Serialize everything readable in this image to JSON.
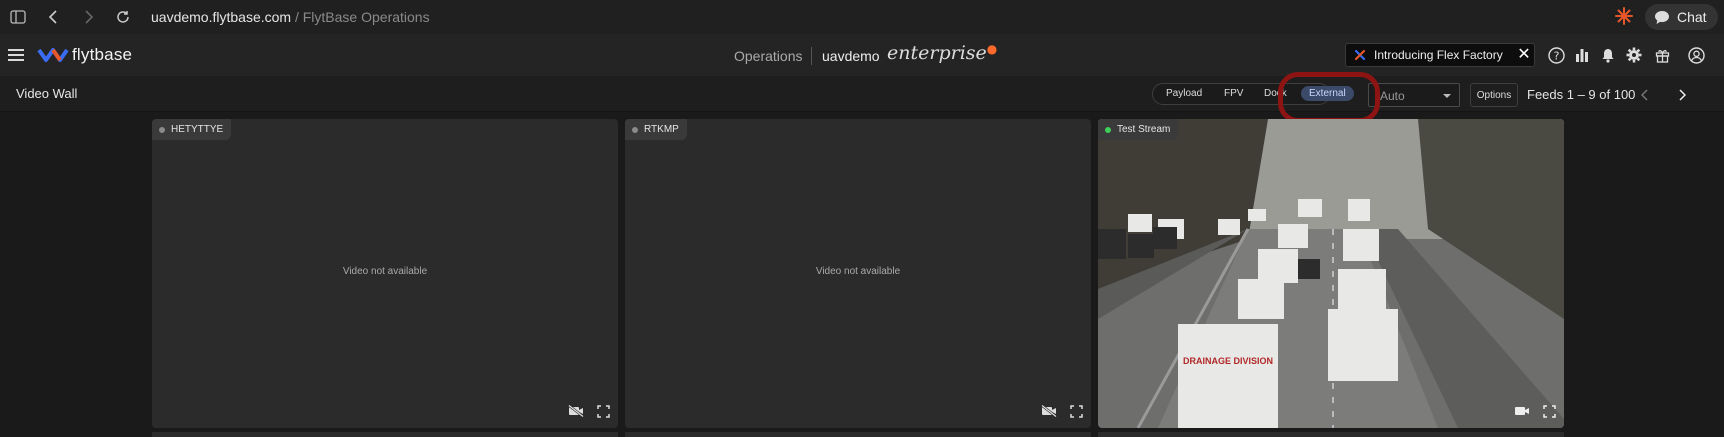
{
  "browser": {
    "url_domain": "uavdemo.flytbase.com",
    "url_separator": " / ",
    "url_page": "FlytBase Operations",
    "chat_label": "Chat"
  },
  "header": {
    "logo_text": "flytbase",
    "section": "Operations",
    "org": "uavdemo",
    "edition": "enterprise",
    "promo": {
      "text": "Introducing Flex Factory"
    }
  },
  "subheader": {
    "title": "Video Wall",
    "filters": [
      "Payload",
      "FPV",
      "Dock",
      "External"
    ],
    "active_filter": "External",
    "quality_value": "Auto",
    "options_label": "Options",
    "feeds_text": "Feeds 1 – 9 of 100"
  },
  "tiles": [
    {
      "name": "HETYTTYE",
      "status": "offline",
      "message": "Video not available"
    },
    {
      "name": "RTKMP",
      "status": "offline",
      "message": "Video not available"
    },
    {
      "name": "Test Stream",
      "status": "live",
      "message": ""
    }
  ],
  "colors": {
    "live": "#3ecf5a",
    "offline": "#8a8a8a",
    "highlight": "#8e1414",
    "active_filter_bg": "#3c4a6a"
  }
}
